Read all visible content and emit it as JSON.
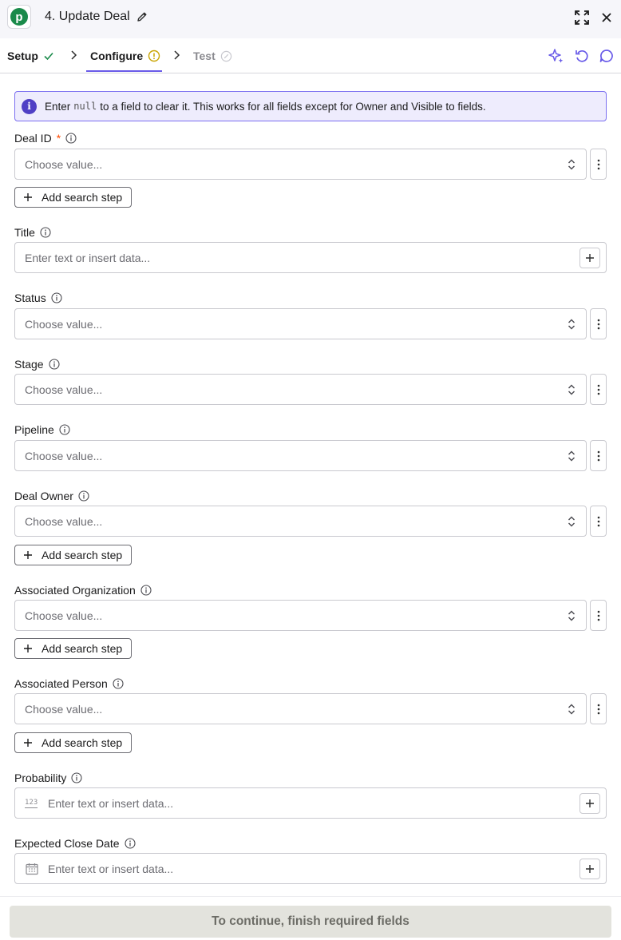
{
  "header": {
    "title": "4. Update Deal",
    "app_icon_letter": "p",
    "app_color": "#1a8a4a"
  },
  "tabs": [
    {
      "label": "Setup",
      "status": "complete"
    },
    {
      "label": "Configure",
      "status": "warning",
      "active": true
    },
    {
      "label": "Test",
      "status": "disabled"
    }
  ],
  "banner": {
    "prefix": "Enter",
    "code": "null",
    "suffix": "to a field to clear it. This works for all fields except for Owner and Visible to fields."
  },
  "fields": {
    "deal_id": {
      "label": "Deal ID",
      "required_mark": "*",
      "placeholder": "Choose value..."
    },
    "title": {
      "label": "Title",
      "placeholder": "Enter text or insert data..."
    },
    "status": {
      "label": "Status",
      "placeholder": "Choose value..."
    },
    "stage": {
      "label": "Stage",
      "placeholder": "Choose value..."
    },
    "pipeline": {
      "label": "Pipeline",
      "placeholder": "Choose value..."
    },
    "deal_owner": {
      "label": "Deal Owner",
      "placeholder": "Choose value..."
    },
    "associated_organization": {
      "label": "Associated Organization",
      "placeholder": "Choose value..."
    },
    "associated_person": {
      "label": "Associated Person",
      "placeholder": "Choose value..."
    },
    "probability": {
      "label": "Probability",
      "placeholder": "Enter text or insert data...",
      "type_glyph": "123"
    },
    "expected_close_date": {
      "label": "Expected Close Date",
      "placeholder": "Enter text or insert data..."
    }
  },
  "add_search_step_label": "Add search step",
  "footer": {
    "continue_label": "To continue, finish required fields"
  },
  "colors": {
    "accent": "#695be8",
    "required": "#ff4a00",
    "warning": "#c9a400",
    "success": "#1a8a4a"
  }
}
